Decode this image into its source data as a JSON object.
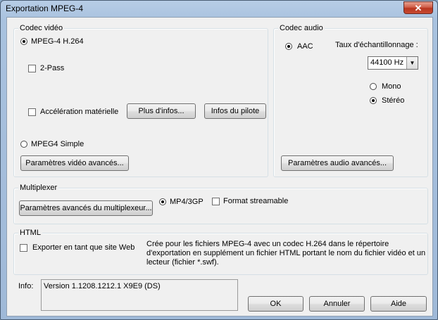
{
  "window": {
    "title": "Exportation MPEG-4",
    "close_label": "✕"
  },
  "video": {
    "group_label": "Codec vidéo",
    "h264_label": "MPEG-4 H.264",
    "twopass_label": "2-Pass",
    "hwaccel_label": "Accélération matérielle",
    "more_info_button": "Plus d'infos...",
    "driver_info_button": "Infos du pilote",
    "simple_label": "MPEG4 Simple",
    "advanced_button": "Paramètres vidéo avancés..."
  },
  "audio": {
    "group_label": "Codec audio",
    "aac_label": "AAC",
    "samplerate_label": "Taux d'échantillonnage :",
    "samplerate_value": "44100 Hz",
    "mono_label": "Mono",
    "stereo_label": "Stéréo",
    "advanced_button": "Paramètres audio avancés..."
  },
  "mux": {
    "group_label": "Multiplexer",
    "advanced_button": "Paramètres avancés du multiplexeur...",
    "mp4_label": "MP4/3GP",
    "streamable_label": "Format streamable"
  },
  "html": {
    "group_label": "HTML",
    "export_label": "Exporter en tant que site Web",
    "description": "Crée pour les fichiers MPEG-4 avec un codec H.264 dans le répertoire d'exportation en supplément un fichier HTML portant le nom du fichier vidéo et un lecteur (fichier *.swf)."
  },
  "info": {
    "label": "Info:",
    "text": "Version 1.1208.1212.1 X9E9 (DS)"
  },
  "buttons": {
    "ok": "OK",
    "cancel": "Annuler",
    "help": "Aide"
  }
}
